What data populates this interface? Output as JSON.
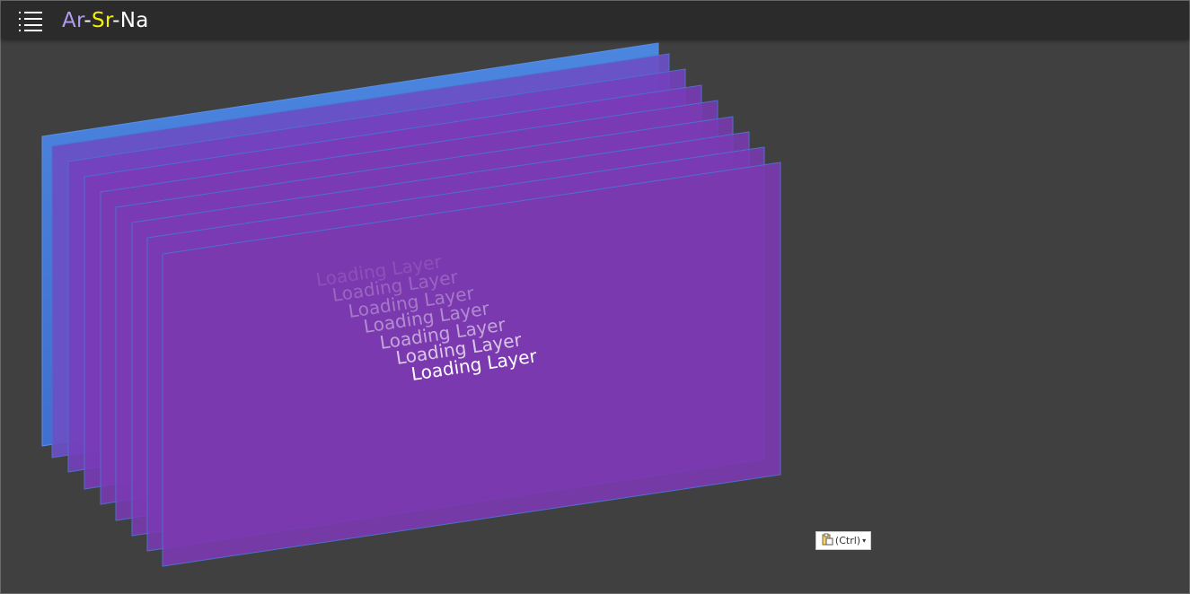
{
  "header": {
    "title_part1": "Ar",
    "sep1": "-",
    "title_part2": "Sr",
    "sep2": "-",
    "title_part3": "Na",
    "menu_icon": "list-menu-icon"
  },
  "canvas": {
    "layer_label": "Loading Layer",
    "colors": {
      "front_layer": "#7a3ab0",
      "back_layer": "#4a7fd8",
      "background": "#404040"
    }
  },
  "paste_options": {
    "label": "(Ctrl)",
    "icon": "clipboard-icon"
  }
}
